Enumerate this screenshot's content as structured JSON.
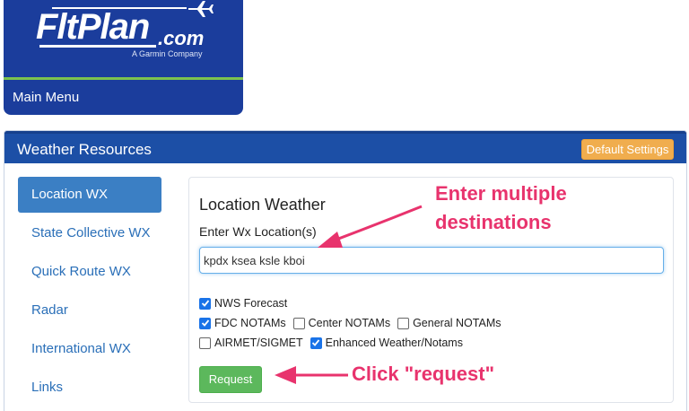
{
  "logo": {
    "brand": "FltPlan",
    "suffix": ".com",
    "tagline": "A Garmin Company"
  },
  "main_menu": "Main Menu",
  "panel": {
    "title": "Weather Resources",
    "default_settings": "Default Settings"
  },
  "nav": {
    "items": [
      {
        "label": "Location WX",
        "active": true
      },
      {
        "label": "State Collective WX"
      },
      {
        "label": "Quick Route WX"
      },
      {
        "label": "Radar"
      },
      {
        "label": "International WX"
      },
      {
        "label": "Links"
      }
    ]
  },
  "content": {
    "title": "Location Weather",
    "field_label": "Enter Wx Location(s)",
    "input_value": "kpdx ksea ksle kboi",
    "checkboxes": [
      {
        "label": "NWS Forecast",
        "checked": true
      },
      {
        "label": "FDC NOTAMs",
        "checked": true
      },
      {
        "label": "Center NOTAMs",
        "checked": false
      },
      {
        "label": "General NOTAMs",
        "checked": false
      },
      {
        "label": "AIRMET/SIGMET",
        "checked": false
      },
      {
        "label": "Enhanced Weather/Notams",
        "checked": true
      }
    ],
    "request_label": "Request"
  },
  "annotations": {
    "note1_line1": "Enter multiple",
    "note1_line2": "destinations",
    "note2": "Click \"request\""
  },
  "colors": {
    "brand_blue": "#1b3d9c",
    "header_blue": "#1c4fa6",
    "active_nav": "#3b7fc4",
    "accent_orange": "#f0ad4e",
    "button_green": "#5cb85c",
    "annotation_pink": "#e8336d"
  }
}
